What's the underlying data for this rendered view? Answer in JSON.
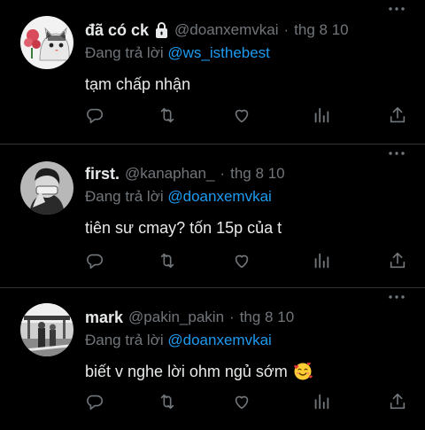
{
  "feed": {
    "tweets": [
      {
        "display_name": "đã có ck",
        "handle": "@doanxemvkai",
        "date": "thg 8 10",
        "separator": "·",
        "reply_prefix": "Đang trả lời",
        "reply_to": "@ws_isthebest",
        "text": "tạm chấp nhận",
        "protected": true
      },
      {
        "display_name": "first.",
        "handle": "@kanaphan_",
        "date": "thg 8 10",
        "separator": "·",
        "reply_prefix": "Đang trả lời",
        "reply_to": "@doanxemvkai",
        "text": "tiên sư cmay? tốn 15p của t"
      },
      {
        "display_name": "mark",
        "handle": "@pakin_pakin",
        "date": "thg 8 10",
        "separator": "·",
        "reply_prefix": "Đang trả lời",
        "reply_to": "@doanxemvkai",
        "text": "biết v nghe lời ohm ngủ sớm",
        "emoji": "smiling-face-with-hearts"
      }
    ]
  },
  "icons": {
    "reply": "reply-icon",
    "retweet": "retweet-icon",
    "like": "heart-icon",
    "views": "views-icon",
    "share": "share-icon",
    "more": "more-icon",
    "lock": "lock-icon"
  },
  "colors": {
    "background": "#000000",
    "text": "#e7e9ea",
    "muted": "#71767b",
    "link": "#1d9bf0",
    "divider": "#2f3336"
  }
}
